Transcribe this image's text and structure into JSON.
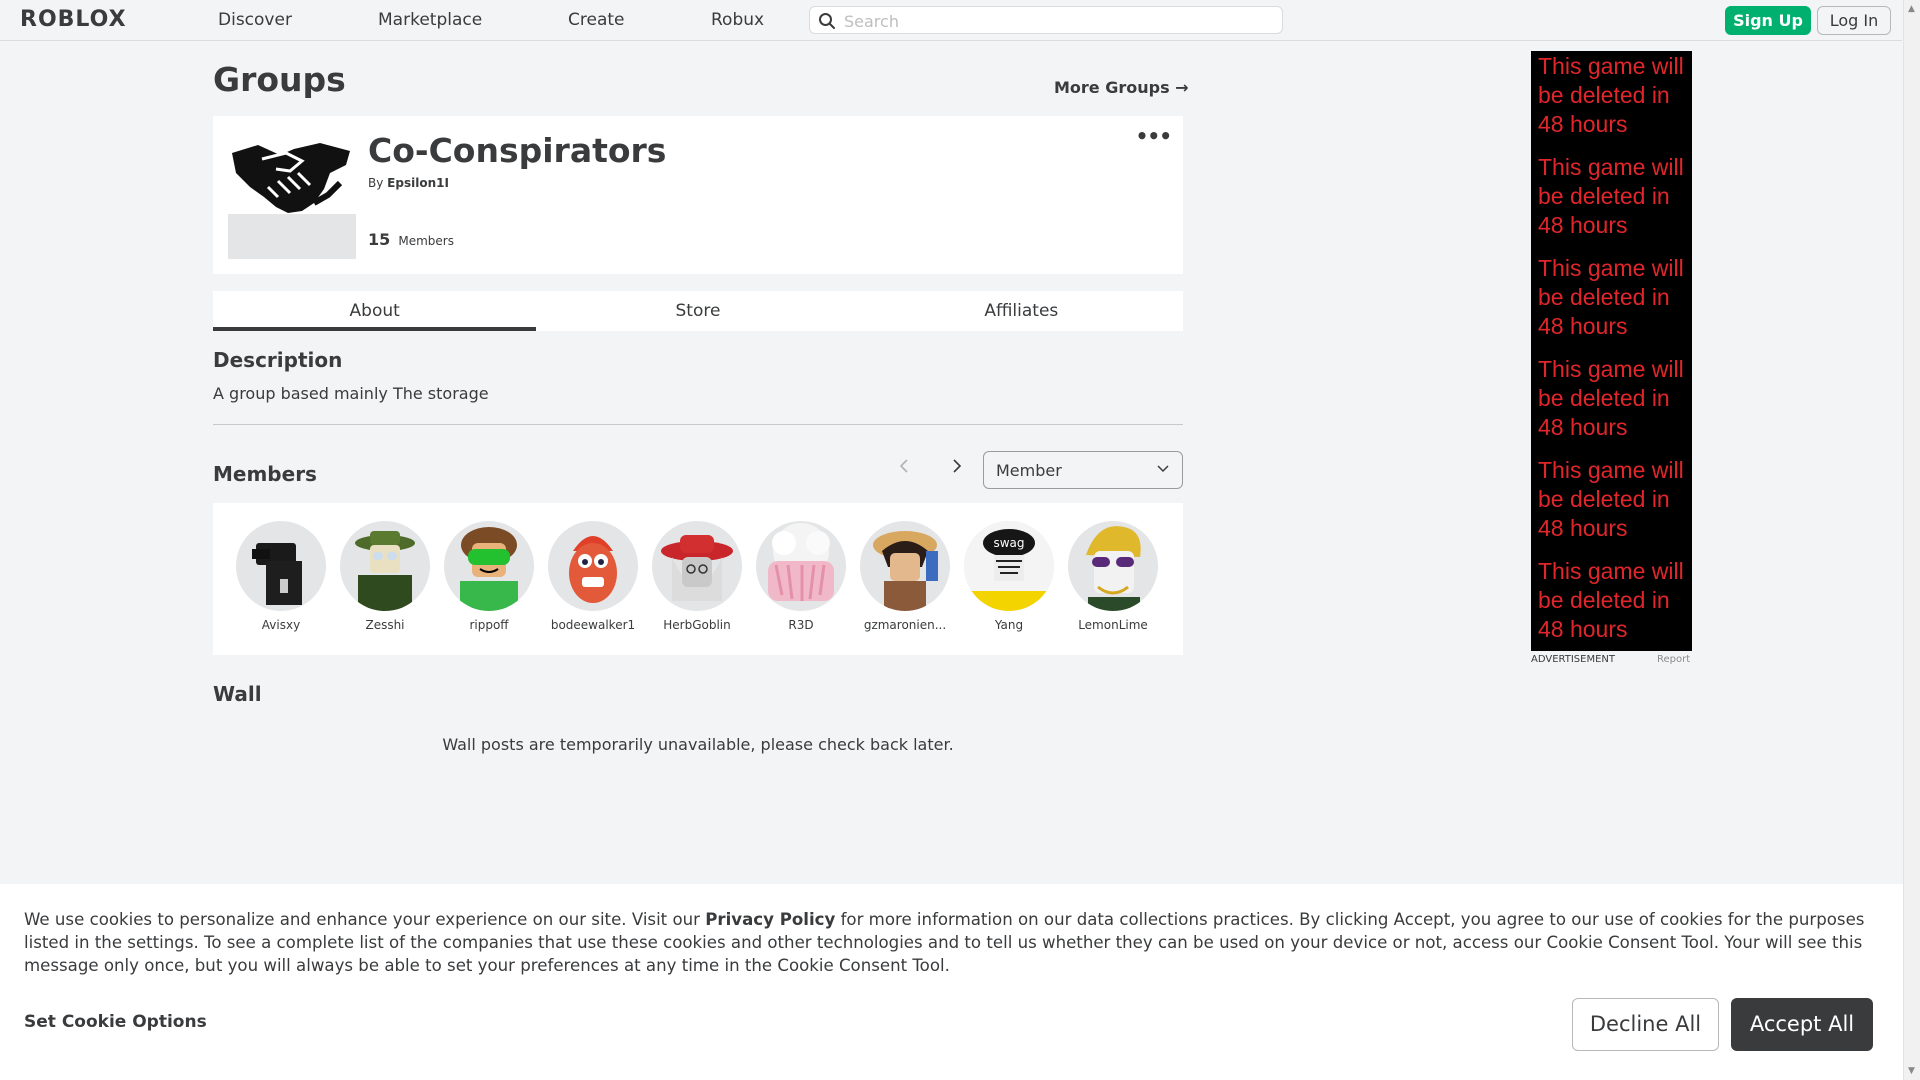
{
  "nav": {
    "logo": "ROBLOX",
    "links": [
      "Discover",
      "Marketplace",
      "Create",
      "Robux"
    ],
    "search_placeholder": "Search",
    "signup": "Sign Up",
    "login": "Log In"
  },
  "page": {
    "title": "Groups",
    "more_groups": "More Groups →"
  },
  "group": {
    "name": "Co-Conspirators",
    "by_label": "By",
    "owner": "Epsilon1I",
    "member_count": "15",
    "members_label": "Members",
    "more_menu": "•••"
  },
  "tabs": [
    "About",
    "Store",
    "Affiliates"
  ],
  "about": {
    "description_heading": "Description",
    "description": "A group based mainly The storage",
    "members_heading": "Members",
    "role_selected": "Member",
    "wall_heading": "Wall",
    "wall_message": "Wall posts are temporarily unavailable, please check back later."
  },
  "members": [
    {
      "name": "Avisxy"
    },
    {
      "name": "Zesshi"
    },
    {
      "name": "rippoff"
    },
    {
      "name": "bodeewalker1"
    },
    {
      "name": "HerbGoblin"
    },
    {
      "name": "R3D"
    },
    {
      "name": "gzmaronien..."
    },
    {
      "name": "Yang"
    },
    {
      "name": "LemonLime"
    }
  ],
  "ad": {
    "lines": [
      "This game will be deleted in 48 hours",
      "This game will be deleted in 48 hours",
      "This game will be deleted in 48 hours",
      "This game will be deleted in 48 hours",
      "This game will be deleted in 48 hours",
      "This game will be deleted in 48 hours"
    ],
    "label": "ADVERTISEMENT",
    "report": "Report",
    "avatar_swag_text": "swag"
  },
  "cookie": {
    "text_before": "We use cookies to personalize and enhance your experience on our site. Visit our ",
    "policy_link": "Privacy Policy",
    "text_after": " for more information on our data collections practices. By clicking Accept, you agree to our use of cookies for the purposes listed in the settings. To see a complete list of the companies that use these cookies and other technologies and to tell us whether they can be used on your device or not, access our Cookie Consent Tool. Your will see this message only once, but you will always be able to set your preferences at any time in the Cookie Consent Tool.",
    "set_options": "Set Cookie Options",
    "decline": "Decline All",
    "accept": "Accept All"
  },
  "colors": {
    "accent_green": "#00b06f",
    "text": "#393b3d",
    "background": "#f2f4f5",
    "ad_text": "#e0262b"
  }
}
